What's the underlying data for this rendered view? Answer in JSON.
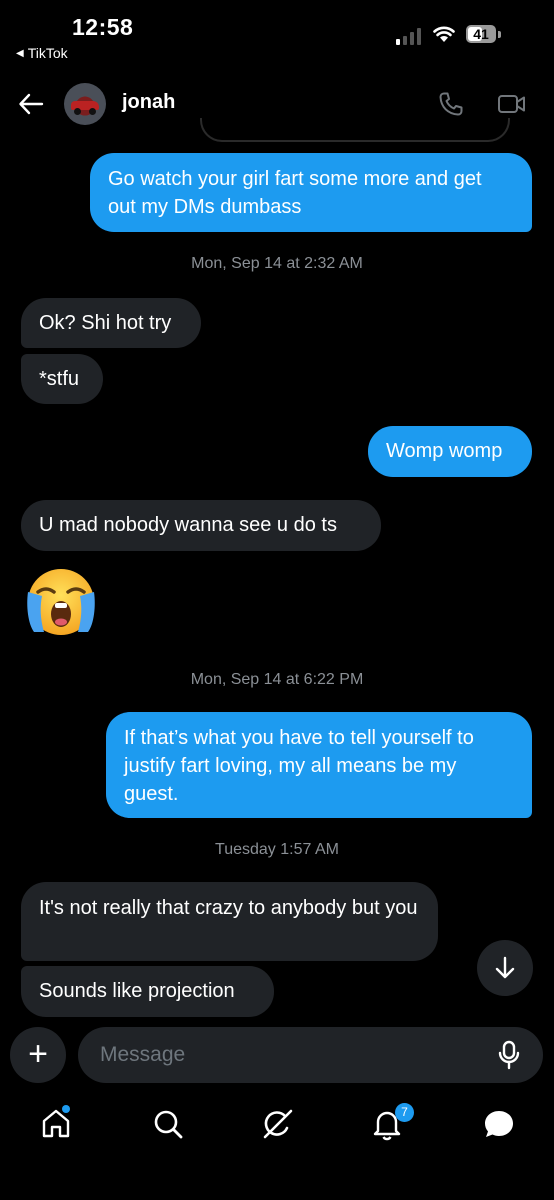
{
  "status_bar": {
    "time": "12:58",
    "back_app": "TikTok",
    "battery": "41"
  },
  "header": {
    "contact_name": "jonah"
  },
  "messages": [
    {
      "from": "me",
      "text": "Go watch your girl fart some more and get out my DMs dumbass"
    },
    {
      "timestamp": "Mon, Sep 14 at 2:32 AM"
    },
    {
      "from": "them",
      "text": "Ok? Shi hot try"
    },
    {
      "from": "them",
      "text": "*stfu"
    },
    {
      "from": "me",
      "text": "Womp womp"
    },
    {
      "from": "them",
      "text": "U mad nobody wanna see u do ts"
    },
    {
      "from": "them",
      "emoji": "loudly-crying-face"
    },
    {
      "timestamp": "Mon, Sep 14 at 6:22 PM"
    },
    {
      "from": "me",
      "text": "If that’s what you have to tell yourself to justify fart loving, my all means be my guest."
    },
    {
      "timestamp": "Tuesday 1:57 AM"
    },
    {
      "from": "them",
      "text": "It's not really that crazy to anybody but you"
    },
    {
      "from": "them",
      "text": "Sounds like projection"
    }
  ],
  "composer": {
    "placeholder": "Message",
    "add_icon": "+"
  },
  "nav": {
    "notifications_badge": "7"
  },
  "colors": {
    "accent": "#1d9bf0",
    "incoming_bubble": "#202327",
    "background": "#000000"
  }
}
